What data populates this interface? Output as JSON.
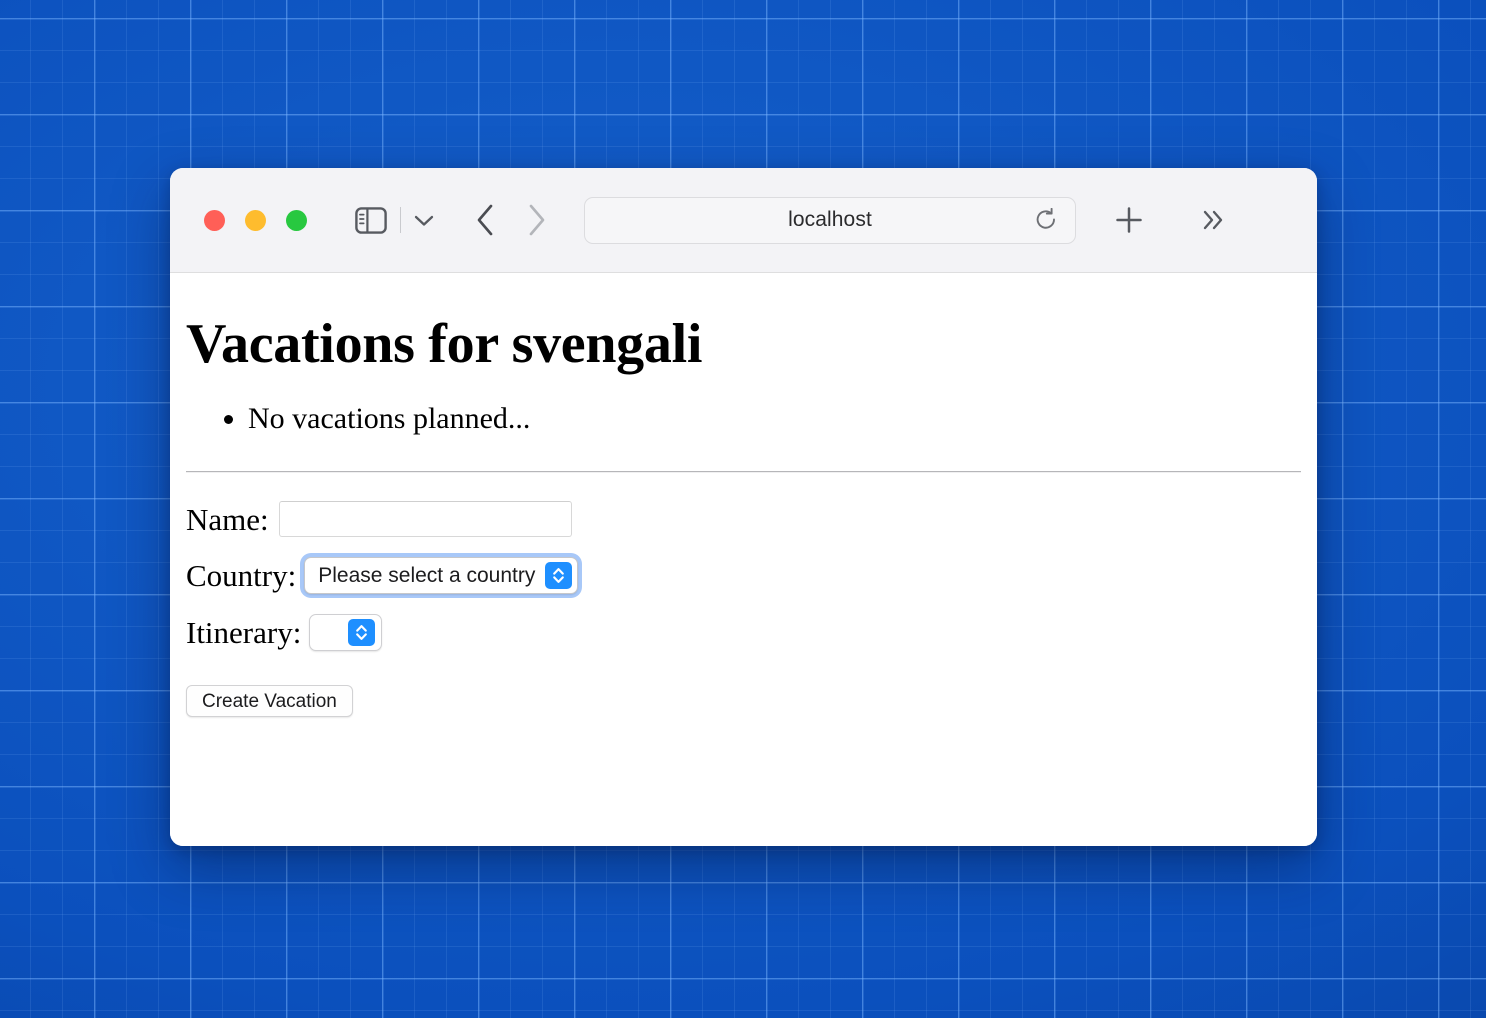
{
  "browser": {
    "traffic_lights": [
      {
        "name": "close",
        "color": "#ff5f57"
      },
      {
        "name": "minimize",
        "color": "#febc2e"
      },
      {
        "name": "maximize",
        "color": "#28c840"
      }
    ],
    "sidebar_toggle_icon": "sidebar-icon",
    "sidebar_dropdown_icon": "chevron-down-icon",
    "back_icon": "chevron-left-icon",
    "forward_icon": "chevron-right-icon",
    "address": {
      "value": "localhost",
      "placeholder": "Search or enter website name",
      "reload_icon": "reload-icon"
    },
    "new_tab_icon": "plus-icon",
    "overflow_icon": "chevrons-right-icon"
  },
  "page": {
    "title": "Vacations for svengali",
    "vacations": [
      "No vacations planned..."
    ],
    "form": {
      "name_label": "Name:",
      "name_value": "",
      "name_placeholder": "",
      "country_label": "Country:",
      "country_selected": "Please select a country",
      "itinerary_label": "Itinerary:",
      "itinerary_selected": "",
      "submit_label": "Create Vacation"
    }
  },
  "colors": {
    "desktop_blue": "#0b50bd",
    "grid_line": "#78b4ff",
    "accent_blue": "#1e8fff",
    "focus_ring": "#a8c8f8",
    "toolbar_bg": "#f3f3f6"
  }
}
